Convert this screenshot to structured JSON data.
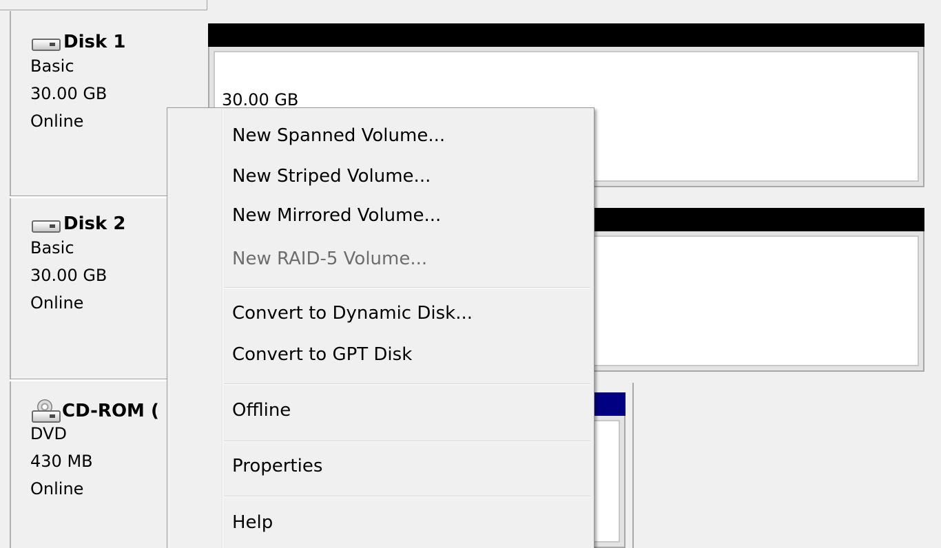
{
  "disks": [
    {
      "name": "Disk 1",
      "type": "Basic",
      "size": "30.00 GB",
      "status": "Online",
      "volume_size": "30.00 GB"
    },
    {
      "name": "Disk 2",
      "type": "Basic",
      "size": "30.00 GB",
      "status": "Online"
    },
    {
      "name": "CD-ROM (",
      "type": "DVD",
      "size": "430 MB",
      "status": "Online"
    }
  ],
  "context_menu": {
    "items": [
      {
        "label": "New Spanned Volume...",
        "enabled": true
      },
      {
        "label": "New Striped Volume...",
        "enabled": true
      },
      {
        "label": "New Mirrored Volume...",
        "enabled": true
      },
      {
        "label": "New RAID-5 Volume...",
        "enabled": false
      },
      {
        "label": "Convert to Dynamic Disk...",
        "enabled": true
      },
      {
        "label": "Convert to GPT Disk",
        "enabled": true
      },
      {
        "label": "Offline",
        "enabled": true
      },
      {
        "label": "Properties",
        "enabled": true
      },
      {
        "label": "Help",
        "enabled": true
      }
    ]
  },
  "colors": {
    "volume_header": "#000000",
    "cdrom_header": "#000080",
    "menu_background": "#f0f0f0",
    "disabled_text": "#6d6d6d"
  }
}
